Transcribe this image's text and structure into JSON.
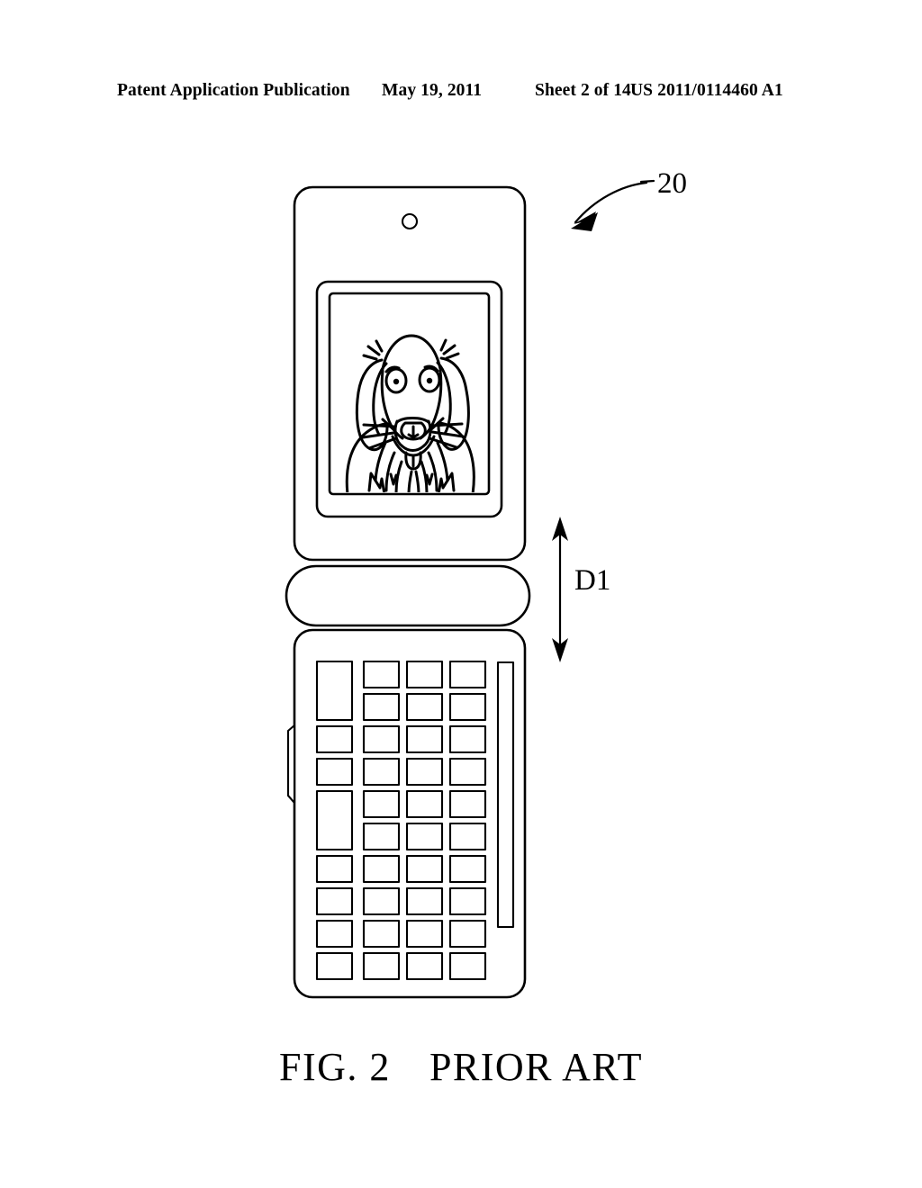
{
  "header": {
    "publication": "Patent Application Publication",
    "date": "May 19, 2011",
    "sheet": "Sheet 2 of 14",
    "doc_number": "US 2011/0114460 A1"
  },
  "figure": {
    "caption_fig": "FIG. 2",
    "caption_note": "PRIOR ART",
    "reference_numeral": "20",
    "dimension_label": "D1"
  },
  "device": {
    "type": "clamshell-flip-phone",
    "screen_content": "dog-line-drawing",
    "upper_panel": {
      "earpiece_icon": "circle-speaker-hole"
    },
    "keypad": {
      "columns": 4,
      "rows": 10,
      "side_bar_key": "vertical-scroll-bar-key",
      "left_side_button": "side-button"
    }
  },
  "colors": {
    "ink": "#000000",
    "paper": "#ffffff"
  }
}
